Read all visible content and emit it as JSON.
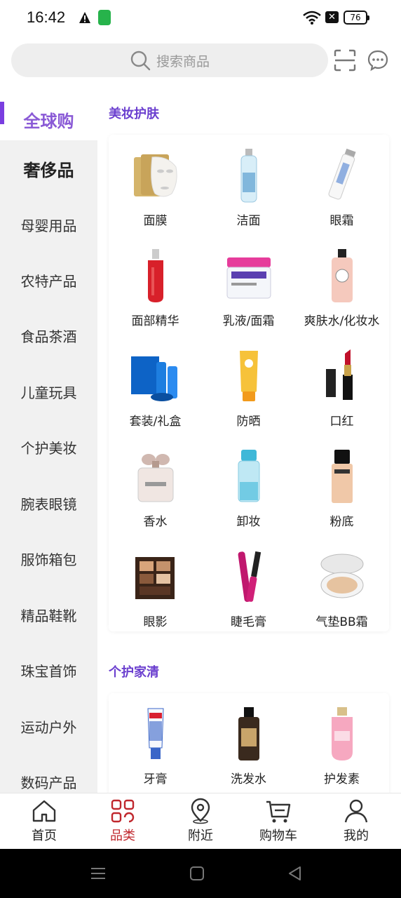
{
  "status_bar": {
    "time": "16:42",
    "battery": "76"
  },
  "search": {
    "placeholder": "搜索商品"
  },
  "side_nav": {
    "items": [
      {
        "label": "全球购"
      },
      {
        "label": "奢侈品"
      },
      {
        "label": "母婴用品"
      },
      {
        "label": "农特产品"
      },
      {
        "label": "食品茶酒"
      },
      {
        "label": "儿童玩具"
      },
      {
        "label": "个护美妆"
      },
      {
        "label": "腕表眼镜"
      },
      {
        "label": "服饰箱包"
      },
      {
        "label": "精品鞋靴"
      },
      {
        "label": "珠宝首饰"
      },
      {
        "label": "运动户外"
      },
      {
        "label": "数码产品"
      }
    ]
  },
  "sections": [
    {
      "title": "美妆护肤",
      "items": [
        {
          "label": "面膜",
          "icon": "face-mask-product-image"
        },
        {
          "label": "洁面",
          "icon": "cleanser-product-image"
        },
        {
          "label": "眼霜",
          "icon": "eye-cream-product-image"
        },
        {
          "label": "面部精华",
          "icon": "serum-product-image"
        },
        {
          "label": "乳液/面霜",
          "icon": "face-cream-product-image"
        },
        {
          "label": "爽肤水/化妆水",
          "icon": "toner-product-image"
        },
        {
          "label": "套装/礼盒",
          "icon": "gift-set-product-image"
        },
        {
          "label": "防晒",
          "icon": "sunscreen-product-image"
        },
        {
          "label": "口红",
          "icon": "lipstick-product-image"
        },
        {
          "label": "香水",
          "icon": "perfume-product-image"
        },
        {
          "label": "卸妆",
          "icon": "makeup-remover-product-image"
        },
        {
          "label": "粉底",
          "icon": "foundation-product-image"
        },
        {
          "label": "眼影",
          "icon": "eyeshadow-product-image"
        },
        {
          "label": "睫毛膏",
          "icon": "mascara-product-image"
        },
        {
          "label": "气垫BB霜",
          "icon": "cushion-bb-product-image"
        }
      ]
    },
    {
      "title": "个护家清",
      "items": [
        {
          "label": "牙膏",
          "icon": "toothpaste-product-image"
        },
        {
          "label": "洗发水",
          "icon": "shampoo-product-image"
        },
        {
          "label": "护发素",
          "icon": "conditioner-product-image"
        }
      ]
    }
  ],
  "tab_bar": {
    "tabs": [
      {
        "label": "首页",
        "icon": "home-icon"
      },
      {
        "label": "品类",
        "icon": "category-icon"
      },
      {
        "label": "附近",
        "icon": "location-icon"
      },
      {
        "label": "购物车",
        "icon": "cart-icon"
      },
      {
        "label": "我的",
        "icon": "profile-icon"
      }
    ]
  },
  "colors": {
    "accent": "#7a3ee0",
    "section_title": "#6b3fcf",
    "active_tab": "#c0272d"
  }
}
